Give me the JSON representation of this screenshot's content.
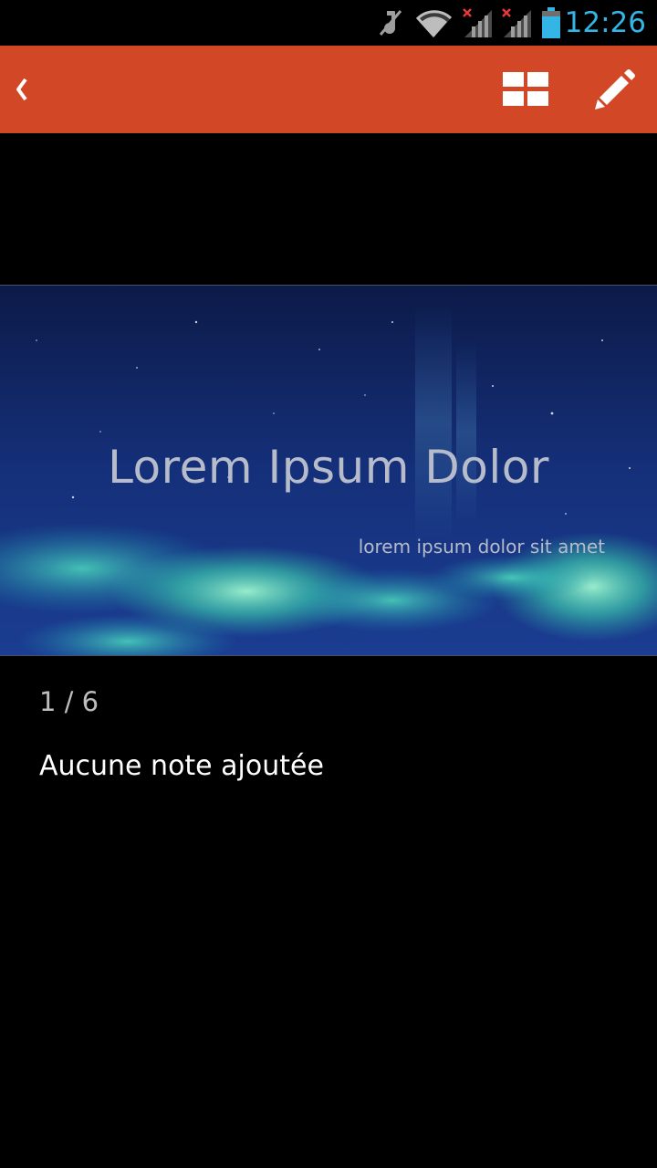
{
  "status_bar": {
    "time": "12:26",
    "time_color": "#33b5e5",
    "icons": [
      "mute-icon",
      "wifi-icon",
      "signal-no-service-icon",
      "signal-no-service-icon",
      "battery-icon"
    ]
  },
  "action_bar": {
    "background_color": "#d24726",
    "back_icon": "chevron-left-icon",
    "grid_icon": "slide-grid-icon",
    "edit_icon": "pencil-icon"
  },
  "slide": {
    "title": "Lorem Ipsum Dolor",
    "subtitle": "lorem ipsum dolor sit amet"
  },
  "slide_counter": "1 / 6",
  "notes": "Aucune note ajoutée"
}
